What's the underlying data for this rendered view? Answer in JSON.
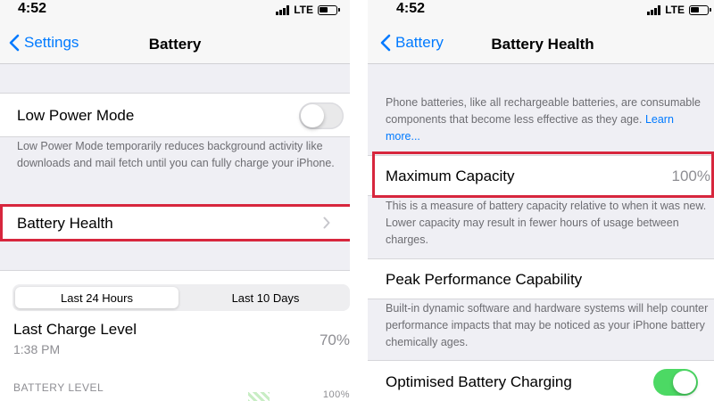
{
  "left": {
    "status": {
      "time": "4:52",
      "carrier": "LTE"
    },
    "nav": {
      "back_label": "Settings",
      "title": "Battery"
    },
    "low_power": {
      "label": "Low Power Mode",
      "toggle_on": false,
      "footer": "Low Power Mode temporarily reduces background activity like downloads and mail fetch until you can fully charge your iPhone."
    },
    "battery_health": {
      "label": "Battery Health"
    },
    "segmented": {
      "options": [
        "Last 24 Hours",
        "Last 10 Days"
      ],
      "selected": 0
    },
    "last_charge": {
      "label": "Last Charge Level",
      "time": "1:38 PM",
      "value": "70%"
    },
    "battery_level": {
      "label": "BATTERY LEVEL",
      "axis_max": "100%"
    }
  },
  "right": {
    "status": {
      "time": "4:52",
      "carrier": "LTE"
    },
    "nav": {
      "back_label": "Battery",
      "title": "Battery Health"
    },
    "intro": {
      "text": "Phone batteries, like all rechargeable batteries, are consumable components that become less effective as they age.",
      "link": "Learn more..."
    },
    "max_capacity": {
      "label": "Maximum Capacity",
      "value": "100%",
      "footer": "This is a measure of battery capacity relative to when it was new. Lower capacity may result in fewer hours of usage between charges."
    },
    "peak": {
      "label": "Peak Performance Capability",
      "footer": "Built-in dynamic software and hardware systems will help counter performance impacts that may be noticed as your iPhone battery chemically ages."
    },
    "optimised": {
      "label": "Optimised Battery Charging",
      "toggle_on": true
    }
  },
  "colors": {
    "accent": "#007aff",
    "toggle_on": "#4cd964",
    "highlight": "#d7263d",
    "grouped_bg": "#efeff4"
  }
}
